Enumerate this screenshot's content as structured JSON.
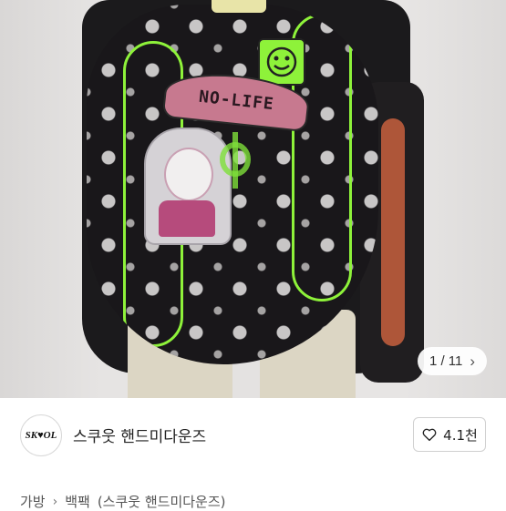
{
  "photo": {
    "alt_label": "product photo",
    "patch_text": "NO-LIFE",
    "counter": {
      "current": "1",
      "separator": "/",
      "total": "11"
    }
  },
  "shop": {
    "avatar_text": "SK♥OL",
    "name": "스쿠웃 핸드미다운즈",
    "like_count": "4.1천"
  },
  "breadcrumb": {
    "items": [
      "가방",
      "백팩",
      "(스쿠웃 핸드미다운즈)"
    ]
  },
  "colors": {
    "accent_green": "#8ef23a",
    "bag_black": "#19171a",
    "patch_pink": "#c7798f"
  }
}
